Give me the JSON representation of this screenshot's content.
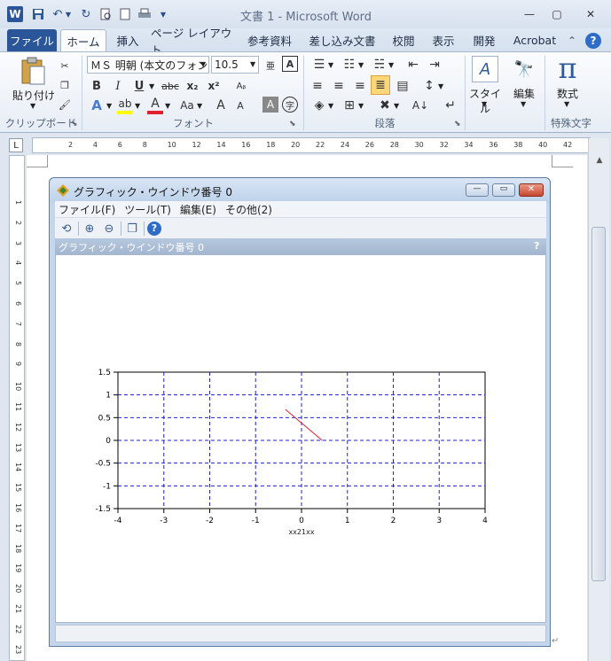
{
  "app": {
    "title": "文書 1 - Microsoft Word",
    "word_icon": "W",
    "quick_access": [
      "save-icon",
      "undo-icon",
      "redo-icon",
      "print-preview-icon",
      "new-document-icon",
      "print-icon",
      "customize-dropdown-icon"
    ]
  },
  "ribbon": {
    "tabs": [
      {
        "label": "ファイル",
        "name": "tab-file"
      },
      {
        "label": "ホーム",
        "name": "tab-home"
      },
      {
        "label": "挿入",
        "name": "tab-insert"
      },
      {
        "label": "ページ レイアウト",
        "name": "tab-page-layout"
      },
      {
        "label": "参考資料",
        "name": "tab-references"
      },
      {
        "label": "差し込み文書",
        "name": "tab-mailings"
      },
      {
        "label": "校閲",
        "name": "tab-review"
      },
      {
        "label": "表示",
        "name": "tab-view"
      },
      {
        "label": "開発",
        "name": "tab-developer"
      },
      {
        "label": "Acrobat",
        "name": "tab-acrobat"
      }
    ],
    "clipboard": {
      "paste_label": "貼り付け",
      "group_label": "クリップボード"
    },
    "font": {
      "font_name": "ＭＳ 明朝 (本文のフォン",
      "font_size": "10.5",
      "group_label": "フォント",
      "bold": "B",
      "italic": "I",
      "underline": "U",
      "strike": "abc",
      "subscript": "x₂",
      "superscript": "x²",
      "grow": "A",
      "shrink": "A",
      "change_case": "Aa",
      "char_shading": "A",
      "enclose": "字"
    },
    "paragraph": {
      "group_label": "段落"
    },
    "styles": {
      "label": "スタイル"
    },
    "editing": {
      "label": "編集"
    },
    "special": {
      "equation_symbol": "π",
      "equation_label": "数式",
      "group_label": "特殊文字"
    }
  },
  "ruler": {
    "h_ticks": [
      "2",
      "4",
      "6",
      "8",
      "10",
      "12",
      "14",
      "16",
      "18",
      "20",
      "22",
      "24",
      "26",
      "28",
      "30",
      "32",
      "34",
      "36",
      "38",
      "40",
      "42"
    ],
    "v_ticks": [
      "1",
      "2",
      "3",
      "4",
      "5",
      "6",
      "7",
      "8",
      "9",
      "10",
      "11",
      "12",
      "13",
      "14",
      "15",
      "16",
      "17",
      "18",
      "19",
      "20",
      "21",
      "22",
      "23"
    ]
  },
  "graphic_window": {
    "title": "グラフィック・ウインドウ番号 0",
    "menu": [
      "ファイル(F)",
      "ツール(T)",
      "編集(E)",
      "その他(2)"
    ],
    "tools": [
      "rotate-icon",
      "zoom-in-icon",
      "zoom-out-icon",
      "windows-icon",
      "help-icon"
    ],
    "subtitle": "グラフィック・ウインドウ番号 0",
    "help_mark": "?"
  },
  "chart_data": {
    "type": "line",
    "title": "",
    "xlabel": "xx21xx",
    "ylabel": "",
    "xlim": [
      -4,
      4
    ],
    "ylim": [
      -1.5,
      1.5
    ],
    "x_ticks": [
      "-4",
      "-3",
      "-2",
      "-1",
      "0",
      "1",
      "2",
      "3",
      "4"
    ],
    "y_ticks": [
      "1.5",
      "1",
      "0.5",
      "0",
      "-0.5",
      "-1",
      "-1.5"
    ],
    "grid": true,
    "grid_color": "#1f1fe0",
    "series": [
      {
        "color": "#e0202a",
        "x": [
          -0.35,
          0.45
        ],
        "y": [
          0.68,
          0.0
        ]
      }
    ]
  }
}
